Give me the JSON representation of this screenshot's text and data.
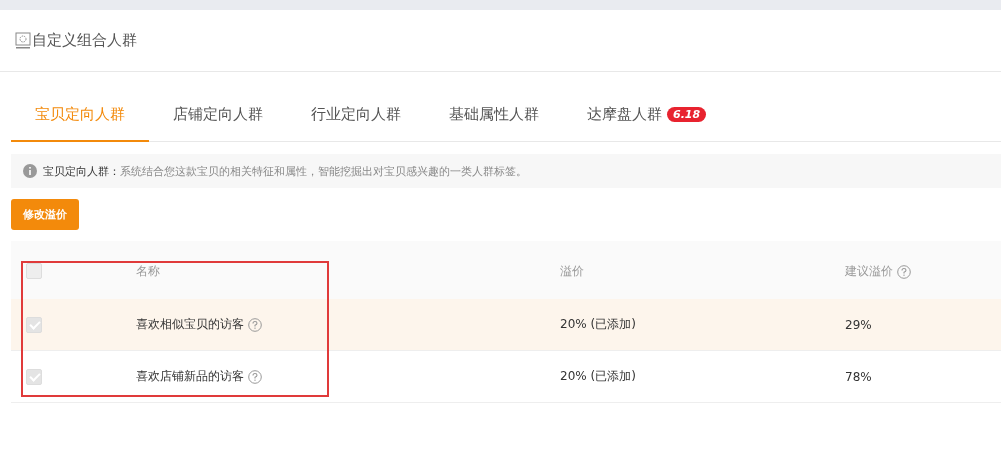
{
  "header": {
    "title": "自定义组合人群"
  },
  "tabs": [
    {
      "label": "宝贝定向人群",
      "selected": true
    },
    {
      "label": "店铺定向人群",
      "selected": false
    },
    {
      "label": "行业定向人群",
      "selected": false
    },
    {
      "label": "基础属性人群",
      "selected": false
    },
    {
      "label": "达摩盘人群",
      "selected": false,
      "badge": "6.18"
    }
  ],
  "notice": {
    "label": "宝贝定向人群：",
    "text": "系统结合您这款宝贝的相关特征和属性，智能挖掘出对宝贝感兴趣的一类人群标签。"
  },
  "action_button": "修改溢价",
  "table": {
    "columns": [
      "名称",
      "溢价",
      "建议溢价"
    ],
    "header_checked": false,
    "rows": [
      {
        "name": "喜欢相似宝贝的访客",
        "premium": "20% (已添加)",
        "suggested": "29%",
        "checked": true,
        "disabled": true,
        "highlighted": true
      },
      {
        "name": "喜欢店铺新品的访客",
        "premium": "20% (已添加)",
        "suggested": "78%",
        "checked": true,
        "disabled": true,
        "highlighted": false
      }
    ]
  }
}
